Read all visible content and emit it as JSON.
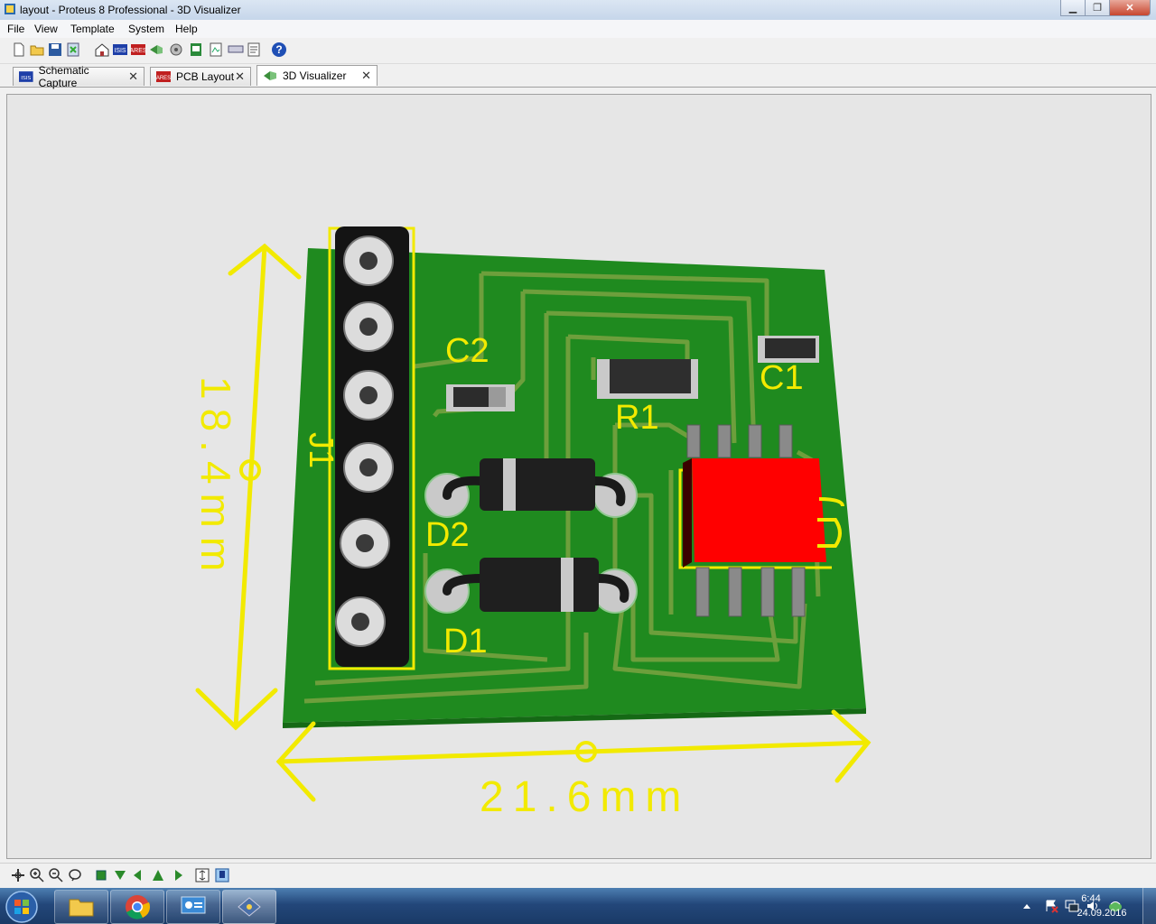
{
  "window": {
    "title": "layout - Proteus 8 Professional - 3D Visualizer"
  },
  "menu": [
    "File",
    "View",
    "Template",
    "System",
    "Help"
  ],
  "tabs": [
    {
      "label": "Schematic Capture",
      "active": false
    },
    {
      "label": "PCB Layout",
      "active": false
    },
    {
      "label": "3D Visualizer",
      "active": true
    }
  ],
  "board": {
    "height_dim": "18.4mm",
    "width_dim": "21.6mm",
    "labels": {
      "j1": "J1",
      "c2": "C2",
      "c1": "C1",
      "r1": "R1",
      "d2": "D2",
      "d1": "D1"
    },
    "colors": {
      "pcb": "#1f8a1f",
      "silk": "#f2ea00",
      "ic": "#ff0000",
      "trace": "#6d9f3c"
    }
  },
  "clock": {
    "time": "6:44",
    "date": "24.09.2016"
  }
}
